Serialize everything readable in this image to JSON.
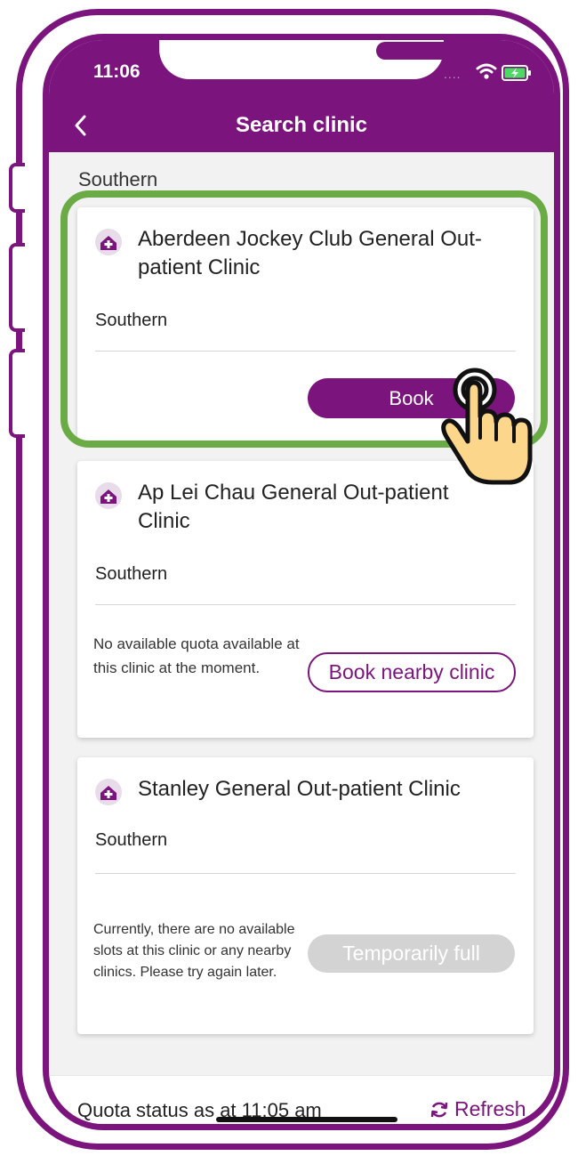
{
  "status_bar": {
    "time": "11:06",
    "signal_dots": "....",
    "wifi_icon": "wifi-icon",
    "battery_icon": "battery-charging-icon"
  },
  "header": {
    "back_icon": "chevron-left-icon",
    "title": "Search clinic"
  },
  "section": {
    "title": "Southern"
  },
  "clinics": [
    {
      "name": "Aberdeen Jockey Club General Out-patient Clinic",
      "district": "Southern",
      "button_label": "Book"
    },
    {
      "name": "Ap Lei Chau General Out-patient Clinic",
      "district": "Southern",
      "message": "No available quota available at this clinic at the moment.",
      "button_label": "Book nearby clinic"
    },
    {
      "name": "Stanley General Out-patient Clinic",
      "district": "Southern",
      "message": "Currently, there are no available slots at this clinic or any nearby clinics. Please try again later.",
      "button_label": "Temporarily full"
    }
  ],
  "footer": {
    "quota_status": "Quota status as at 11:05 am",
    "refresh_label": "Refresh",
    "refresh_icon": "refresh-icon"
  },
  "colors": {
    "brand": "#7b157d",
    "highlight": "#6bab45",
    "disabled": "#d3d3d3",
    "background": "#f2f2f2"
  }
}
